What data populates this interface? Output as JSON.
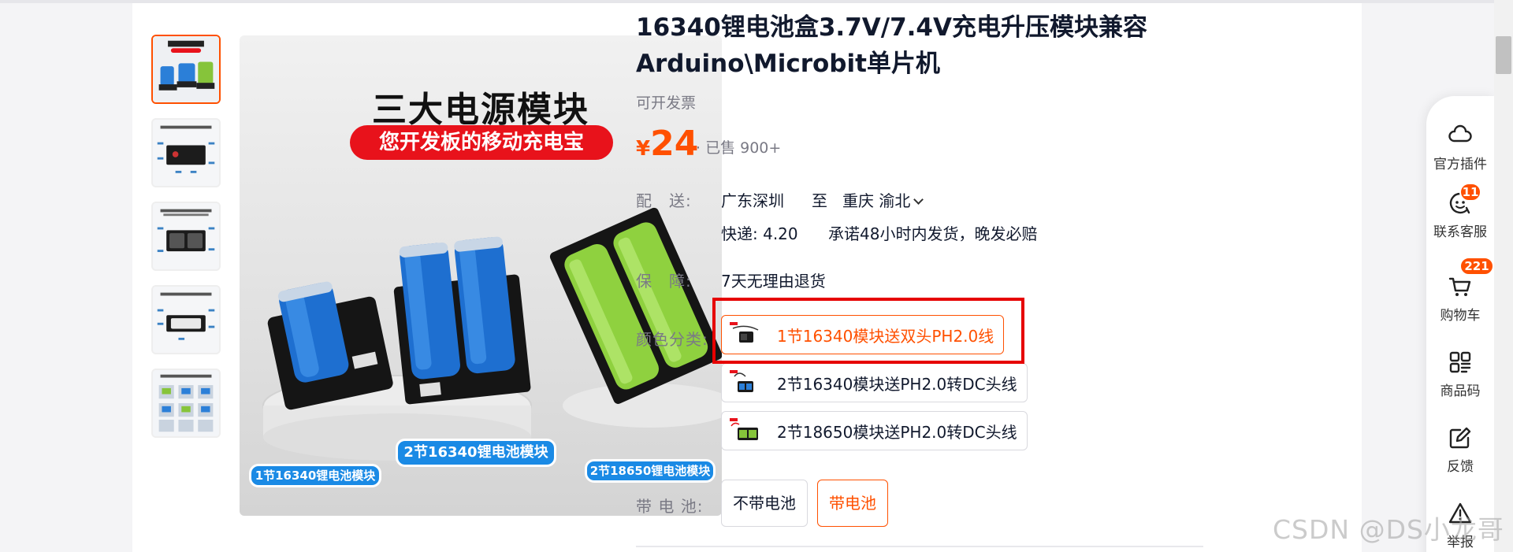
{
  "product": {
    "title": "16340锂电池盒3.7V/7.4V充电升压模块兼容Arduino\\Microbit单片机",
    "invoice": "可开发票",
    "price_symbol": "¥",
    "price": "24",
    "sold": "· 已售 900+"
  },
  "image": {
    "headline": "三大电源模块",
    "subline": "您开发板的移动充电宝",
    "caption_1": "1节16340锂电池模块",
    "caption_2": "2节16340锂电池模块",
    "caption_3": "2节18650锂电池模块"
  },
  "delivery": {
    "label": "配　送:",
    "from": "广东深圳",
    "to_word": "至",
    "destination": "重庆 渝北",
    "shipping": "快递: 4.20",
    "promise": "承诺48小时内发货，晚发必赔"
  },
  "guarantee": {
    "label": "保　障:",
    "value": "7天无理由退货"
  },
  "color": {
    "label": "颜色分类:",
    "options": [
      {
        "label": "1节16340模块送双头PH2.0线",
        "selected": true
      },
      {
        "label": "2节16340模块送PH2.0转DC头线",
        "selected": false
      },
      {
        "label": "2节18650模块送PH2.0转DC头线",
        "selected": false
      }
    ]
  },
  "battery": {
    "label": "带 电 池:",
    "options": [
      {
        "label": "不带电池",
        "selected": false
      },
      {
        "label": "带电池",
        "selected": true
      }
    ]
  },
  "sidebar": {
    "items": [
      {
        "label": "官方插件",
        "icon": "plugin-icon"
      },
      {
        "label": "联系客服",
        "icon": "service-icon",
        "badge": "11"
      },
      {
        "label": "购物车",
        "icon": "cart-icon",
        "badge": "221"
      },
      {
        "label": "商品码",
        "icon": "grid-icon"
      },
      {
        "label": "反馈",
        "icon": "edit-icon"
      },
      {
        "label": "举报",
        "icon": "warning-icon"
      }
    ]
  },
  "watermark": "CSDN @DS小龙哥",
  "colors": {
    "accent": "#ff5000",
    "highlight_box": "#e60000",
    "caption_blue": "#1a8ae5"
  }
}
